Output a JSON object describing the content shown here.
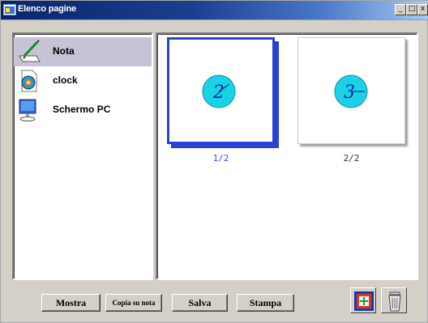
{
  "window": {
    "title": "Elenco pagine",
    "controls": {
      "minimize": "_",
      "maximize": "□",
      "close": "x"
    }
  },
  "sidebar": {
    "items": [
      {
        "label": "Nota",
        "icon": "pencil-note-icon",
        "selected": true
      },
      {
        "label": "clock",
        "icon": "clock-file-icon",
        "selected": false
      },
      {
        "label": "Schermo PC",
        "icon": "pc-screen-icon",
        "selected": false
      }
    ]
  },
  "thumbnails": [
    {
      "number": "2",
      "caption": "1/2",
      "selected": true
    },
    {
      "number": "3",
      "caption": "2/2",
      "selected": false
    }
  ],
  "buttons": {
    "show": "Mostra",
    "copy_to_note": "Copia su nota",
    "save": "Salva",
    "print": "Stampa"
  },
  "icons": {
    "add_page": "add-page-icon",
    "delete": "trash-can-icon"
  },
  "colors": {
    "selection_border": "#2b42d4",
    "clock_face": "#1ad2e6",
    "title_bar": "#0a246a"
  }
}
